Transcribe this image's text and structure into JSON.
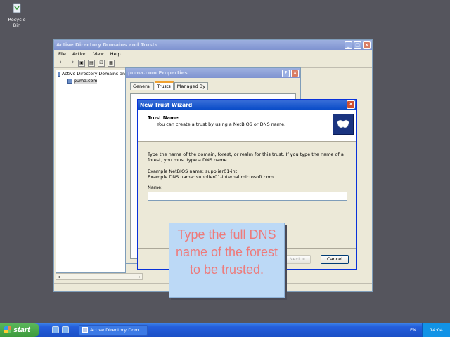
{
  "desktop": {
    "recycle_bin_label": "Recycle Bin"
  },
  "console": {
    "title": "Active Directory Domains and Trusts",
    "menu": [
      "File",
      "Action",
      "View",
      "Help"
    ],
    "tree_root": "Active Directory Domains an",
    "tree_child": "puma.com"
  },
  "properties": {
    "title": "puma.com Properties",
    "tabs": [
      "General",
      "Trusts",
      "Managed By"
    ]
  },
  "wizard": {
    "title": "New Trust Wizard",
    "heading": "Trust Name",
    "subheading": "You can create a trust by using a NetBIOS or DNS name.",
    "body1": "Type the name of the domain, forest, or realm for this trust. If you type the name of a forest, you must type a DNS name.",
    "example_netbios": "Example NetBIOS name: supplier01-int",
    "example_dns": "Example DNS name: supplier01-internal.microsoft.com",
    "name_label": "Name:",
    "name_value": "",
    "next_label": "Next >",
    "cancel_label": "Cancel"
  },
  "callout": {
    "text": "Type the full DNS name of the forest to be trusted."
  },
  "taskbar": {
    "start_label": "start",
    "task_label": "Active Directory Dom...",
    "language": "EN",
    "clock": "14:04"
  }
}
